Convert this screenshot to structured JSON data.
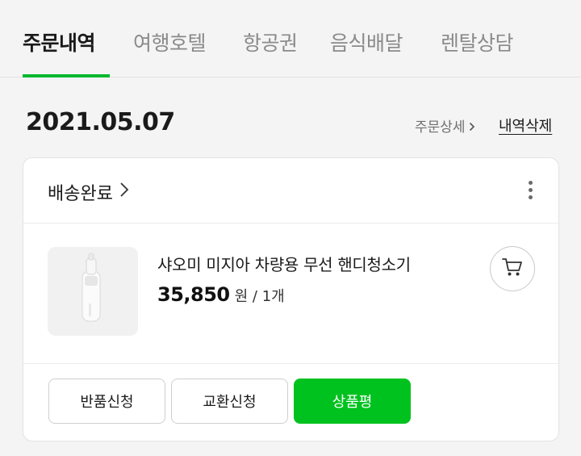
{
  "tabs": [
    {
      "label": "주문내역"
    },
    {
      "label": "여행호텔"
    },
    {
      "label": "항공권"
    },
    {
      "label": "음식배달"
    },
    {
      "label": "렌탈상담"
    }
  ],
  "order": {
    "date": "2021.05.07",
    "detail_link": "주문상세",
    "delete_link": "내역삭제",
    "status": "배송완료",
    "product": {
      "name": "샤오미 미지아 차량용 무선 핸디청소기",
      "price": "35,850",
      "unit_text": "원 / 1개"
    },
    "actions": {
      "return": "반품신청",
      "exchange": "교환신청",
      "review": "상품평"
    }
  },
  "colors": {
    "accent": "#00c21f",
    "tab_underline": "#00b82e"
  },
  "icons": {
    "status_chevron": "chevron-right-icon",
    "menu": "kebab-menu-icon",
    "cart": "cart-icon"
  }
}
